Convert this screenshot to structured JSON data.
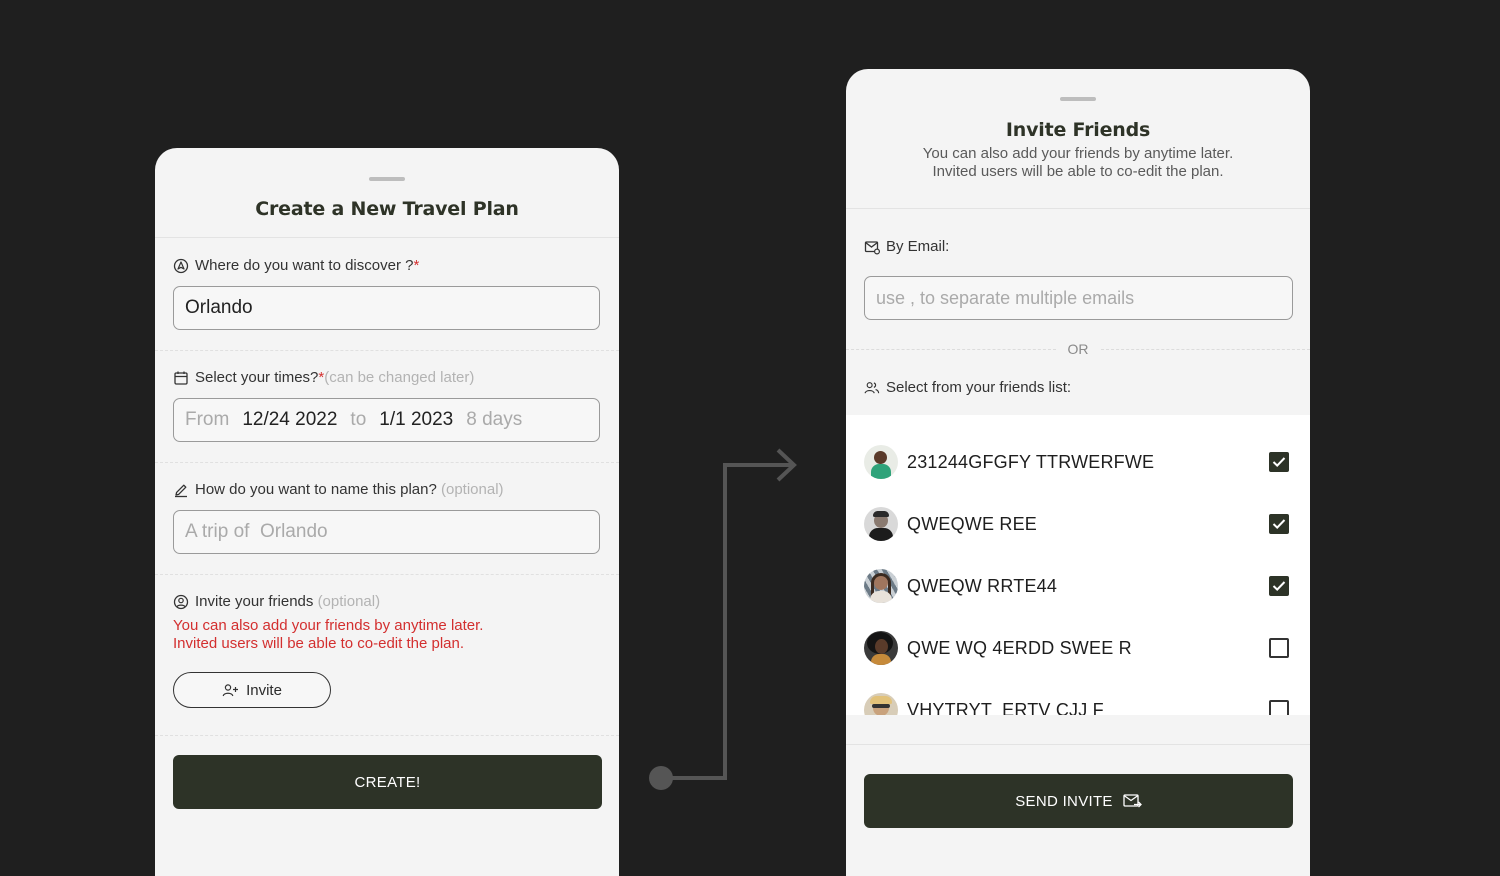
{
  "create_panel": {
    "title": "Create a New Travel Plan",
    "destination": {
      "label": "Where do you want to discover ?",
      "required_mark": "*",
      "value": "Orlando"
    },
    "times": {
      "label": "Select your times?",
      "required_mark": "*",
      "hint": "(can be changed later)",
      "from_label": "From",
      "from_value": "12/24 2022",
      "to_label": "to",
      "to_value": "1/1 2023",
      "duration": "8 days"
    },
    "plan_name": {
      "label": "How do you want to name this plan?",
      "hint": "(optional)",
      "placeholder": "A trip of  Orlando"
    },
    "invite": {
      "label": "Invite your friends",
      "hint": "(optional)",
      "note_line1": "You can also add your friends by anytime later.",
      "note_line2": "Invited users will be able to co-edit the plan.",
      "button_label": "Invite"
    },
    "create_button": "CREATE!"
  },
  "invite_panel": {
    "title": "Invite Friends",
    "subtitle_line1": "You can also add your friends by anytime later.",
    "subtitle_line2": "Invited users will be able to co-edit the plan.",
    "email_label": "By Email:",
    "email_placeholder": "use , to separate multiple emails",
    "or_text": "OR",
    "friends_label": "Select from your friends list:",
    "friends": [
      {
        "name": "231244GFGFY TTRWERFWE",
        "checked": true
      },
      {
        "name": "QWEQWE REE",
        "checked": true
      },
      {
        "name": "QWEQW RRTE44",
        "checked": true
      },
      {
        "name": "QWE WQ 4ERDD SWEE R",
        "checked": false
      },
      {
        "name": "VHYTRYT  ERTV CJJ F",
        "checked": false
      }
    ],
    "send_button": "SEND INVITE"
  },
  "colors": {
    "background": "#1f1f1f",
    "panel": "#f4f4f4",
    "primary": "#2d3327",
    "required": "#d32f2f",
    "muted": "#b3b3b3"
  },
  "icons": [
    "navigation-icon",
    "calendar-icon",
    "edit-icon",
    "user-circle-icon",
    "user-plus-icon",
    "mail-icon",
    "users-icon",
    "check-icon",
    "mail-send-icon",
    "arrow-right-icon"
  ]
}
